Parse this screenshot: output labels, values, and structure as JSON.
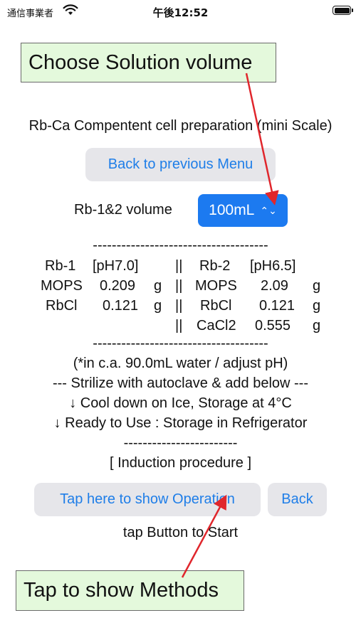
{
  "status_bar": {
    "carrier": "通信事業者",
    "time": "午後12:52"
  },
  "callouts": {
    "top": "Choose Solution volume",
    "bottom": "Tap to show Methods"
  },
  "title": "Rb-Ca Compentent cell preparation (mini Scale)",
  "back_menu_label": "Back to previous Menu",
  "volume": {
    "label": "Rb-1&2 volume",
    "selected": "100mL"
  },
  "divider": "-------------------------------------",
  "table": {
    "separator": "||",
    "left": {
      "header": [
        "Rb-1",
        "[pH7.0]"
      ],
      "rows": [
        {
          "name": "MOPS",
          "amount": "0.209",
          "unit": "g"
        },
        {
          "name": "RbCl",
          "amount": "0.121",
          "unit": "g"
        }
      ]
    },
    "right": {
      "header": [
        "Rb-2",
        "[pH6.5]"
      ],
      "rows": [
        {
          "name": "MOPS",
          "amount": "2.09",
          "unit": "g"
        },
        {
          "name": "RbCl",
          "amount": "0.121",
          "unit": "g"
        },
        {
          "name": "CaCl2",
          "amount": "0.555",
          "unit": "g"
        }
      ]
    }
  },
  "notes": [
    "(*in c.a. 90.0mL water / adjust pH)",
    "--- Strilize with autoclave & add below ---",
    "↓ Cool down on Ice, Storage at 4°C",
    "↓ Ready to Use : Storage in Refrigerator"
  ],
  "short_divider": "------------------------",
  "induction_label": "[ Induction procedure ]",
  "operation_button_label": "Tap here to show Operation",
  "back_button_label": "Back",
  "hint": "tap Button to Start",
  "colors": {
    "accent": "#1c7af0",
    "callout_bg": "#e4f9dc",
    "arrow": "#e0262c"
  },
  "icons": {
    "wifi": "wifi-icon",
    "battery": "battery-icon",
    "select": "chevron-up-down-icon"
  }
}
